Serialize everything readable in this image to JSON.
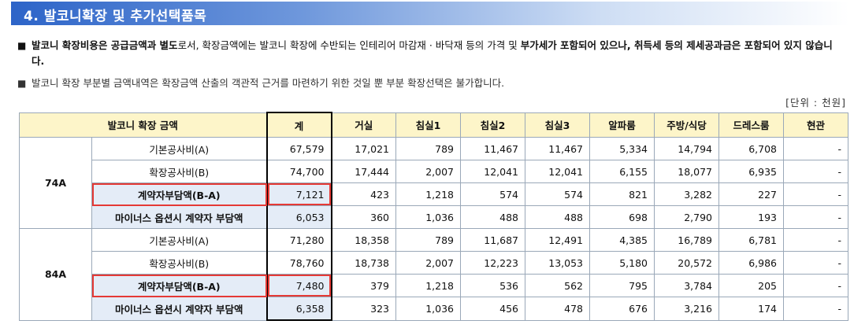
{
  "section": {
    "title": "4. 발코니확장 및 추가선택품목"
  },
  "notes": {
    "bullet": "■",
    "n1_a": "발코니 확장비용은 공급금액과 별도",
    "n1_b": "로서, 확장금액에는 발코니 확장에 수반되는 인테리어 마감재 · 바닥재 등의 가격 및 ",
    "n1_c": "부가세가 포함되어 있으나, 취득세 등의 제세공과금은 포함되어 있지 않습니다.",
    "n2": "발코니 확장 부분별 금액내역은 확장금액 산출의 객관적 근거를 마련하기 위한 것일 뿐 부분 확장선택은 불가합니다."
  },
  "unit": "[단위 : 천원]",
  "table": {
    "headers": [
      "발코니 확장 금액",
      "계",
      "거실",
      "침실1",
      "침실2",
      "침실3",
      "알파룸",
      "주방/식당",
      "드레스룸",
      "현관"
    ],
    "groups": [
      {
        "type": "74A",
        "rows": [
          {
            "label": "기본공사비(A)",
            "values": [
              "67,579",
              "17,021",
              "789",
              "11,467",
              "11,467",
              "5,334",
              "14,794",
              "6,708",
              "-"
            ]
          },
          {
            "label": "확장공사비(B)",
            "values": [
              "74,700",
              "17,444",
              "2,007",
              "12,041",
              "12,041",
              "6,155",
              "18,077",
              "6,935",
              "-"
            ]
          },
          {
            "label": "계약자부담액(B-A)",
            "values": [
              "7,121",
              "423",
              "1,218",
              "574",
              "574",
              "821",
              "3,282",
              "227",
              "-"
            ]
          },
          {
            "label": "마이너스 옵션시 계약자 부담액",
            "values": [
              "6,053",
              "360",
              "1,036",
              "488",
              "488",
              "698",
              "2,790",
              "193",
              "-"
            ]
          }
        ]
      },
      {
        "type": "84A",
        "rows": [
          {
            "label": "기본공사비(A)",
            "values": [
              "71,280",
              "18,358",
              "789",
              "11,687",
              "12,491",
              "4,385",
              "16,789",
              "6,781",
              "-"
            ]
          },
          {
            "label": "확장공사비(B)",
            "values": [
              "78,760",
              "18,738",
              "2,007",
              "12,223",
              "13,053",
              "5,180",
              "20,572",
              "6,986",
              "-"
            ]
          },
          {
            "label": "계약자부담액(B-A)",
            "values": [
              "7,480",
              "379",
              "1,218",
              "536",
              "562",
              "795",
              "3,784",
              "205",
              "-"
            ]
          },
          {
            "label": "마이너스 옵션시 계약자 부담액",
            "values": [
              "6,358",
              "323",
              "1,036",
              "456",
              "478",
              "676",
              "3,216",
              "174",
              "-"
            ]
          }
        ]
      }
    ]
  }
}
